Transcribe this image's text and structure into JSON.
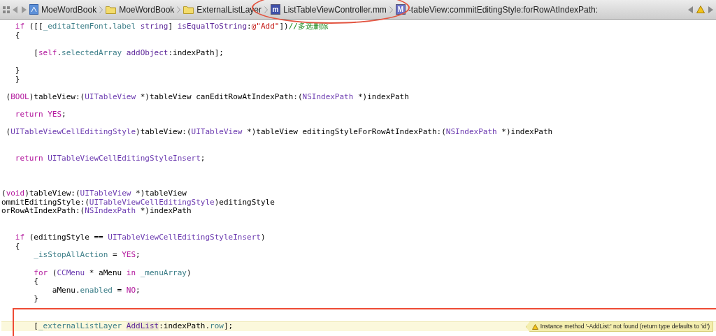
{
  "jump_bar": {
    "crumbs": [
      {
        "kind": "project",
        "label": "MoeWordBook"
      },
      {
        "kind": "folder",
        "label": "MoeWordBook"
      },
      {
        "kind": "folder",
        "label": "ExternalListLayer"
      },
      {
        "kind": "file",
        "label": "ListTableViewController.mm",
        "icon_letter": "m"
      },
      {
        "kind": "method",
        "label": "-tableView:commitEditingStyle:forRowAtIndexPath:",
        "icon_letter": "M"
      }
    ]
  },
  "code_lines": [
    {
      "kind": "code",
      "tokens": [
        {
          "text": "   if",
          "kind": "keyword"
        },
        {
          "text": " ([[",
          "kind": "plain"
        },
        {
          "text": "_editaItemFont",
          "kind": "property"
        },
        {
          "text": ".",
          "kind": "plain"
        },
        {
          "text": "label",
          "kind": "property"
        },
        {
          "text": " string",
          "kind": "method"
        },
        {
          "text": "] ",
          "kind": "plain"
        },
        {
          "text": "isEqualToString",
          "kind": "method"
        },
        {
          "text": ":",
          "kind": "plain"
        },
        {
          "text": "@\"Add\"",
          "kind": "string"
        },
        {
          "text": "])",
          "kind": "plain"
        },
        {
          "text": "//多选删除",
          "kind": "comment"
        }
      ]
    },
    {
      "kind": "code",
      "tokens": [
        {
          "text": "   {",
          "kind": "plain"
        }
      ]
    },
    {
      "kind": "blank"
    },
    {
      "kind": "code",
      "tokens": [
        {
          "text": "       [",
          "kind": "plain"
        },
        {
          "text": "self",
          "kind": "keyword"
        },
        {
          "text": ".",
          "kind": "plain"
        },
        {
          "text": "selectedArray",
          "kind": "property"
        },
        {
          "text": " addObject",
          "kind": "method"
        },
        {
          "text": ":indexPath];",
          "kind": "plain"
        }
      ]
    },
    {
      "kind": "blank"
    },
    {
      "kind": "code",
      "tokens": [
        {
          "text": "   }",
          "kind": "plain"
        }
      ]
    },
    {
      "kind": "code",
      "tokens": [
        {
          "text": "   }",
          "kind": "plain"
        }
      ]
    },
    {
      "kind": "blank"
    },
    {
      "kind": "code",
      "tokens": [
        {
          "text": " (",
          "kind": "plain"
        },
        {
          "text": "BOOL",
          "kind": "keyword"
        },
        {
          "text": ")tableView:(",
          "kind": "plain"
        },
        {
          "text": "UITableView",
          "kind": "type"
        },
        {
          "text": " *)tableView canEditRowAtIndexPath:(",
          "kind": "plain"
        },
        {
          "text": "NSIndexPath",
          "kind": "type"
        },
        {
          "text": " *)indexPath",
          "kind": "plain"
        }
      ]
    },
    {
      "kind": "blank"
    },
    {
      "kind": "code",
      "tokens": [
        {
          "text": "   return",
          "kind": "keyword"
        },
        {
          "text": " YES",
          "kind": "keyword"
        },
        {
          "text": ";",
          "kind": "plain"
        }
      ]
    },
    {
      "kind": "blank"
    },
    {
      "kind": "code",
      "tokens": [
        {
          "text": " (",
          "kind": "plain"
        },
        {
          "text": "UITableViewCellEditingStyle",
          "kind": "type"
        },
        {
          "text": ")tableView:(",
          "kind": "plain"
        },
        {
          "text": "UITableView",
          "kind": "type"
        },
        {
          "text": " *)tableView editingStyleForRowAtIndexPath:(",
          "kind": "plain"
        },
        {
          "text": "NSIndexPath",
          "kind": "type"
        },
        {
          "text": " *)indexPath",
          "kind": "plain"
        }
      ]
    },
    {
      "kind": "blank"
    },
    {
      "kind": "blank"
    },
    {
      "kind": "code",
      "tokens": [
        {
          "text": "   return",
          "kind": "keyword"
        },
        {
          "text": " UITableViewCellEditingStyleInsert",
          "kind": "type"
        },
        {
          "text": ";",
          "kind": "plain"
        }
      ]
    },
    {
      "kind": "blank"
    },
    {
      "kind": "blank"
    },
    {
      "kind": "blank"
    },
    {
      "kind": "code",
      "tokens": [
        {
          "text": "(",
          "kind": "plain"
        },
        {
          "text": "void",
          "kind": "keyword"
        },
        {
          "text": ")tableView:(",
          "kind": "plain"
        },
        {
          "text": "UITableView",
          "kind": "type"
        },
        {
          "text": " *)tableView",
          "kind": "plain"
        }
      ]
    },
    {
      "kind": "code",
      "tokens": [
        {
          "text": "ommitEditingStyle:(",
          "kind": "plain"
        },
        {
          "text": "UITableViewCellEditingStyle",
          "kind": "type"
        },
        {
          "text": ")editingStyle",
          "kind": "plain"
        }
      ]
    },
    {
      "kind": "code",
      "tokens": [
        {
          "text": "orRowAtIndexPath:(",
          "kind": "plain"
        },
        {
          "text": "NSIndexPath",
          "kind": "type"
        },
        {
          "text": " *)indexPath",
          "kind": "plain"
        }
      ]
    },
    {
      "kind": "blank"
    },
    {
      "kind": "blank"
    },
    {
      "kind": "code",
      "tokens": [
        {
          "text": "   if",
          "kind": "keyword"
        },
        {
          "text": " (editingStyle == ",
          "kind": "plain"
        },
        {
          "text": "UITableViewCellEditingStyleInsert",
          "kind": "type"
        },
        {
          "text": ")",
          "kind": "plain"
        }
      ]
    },
    {
      "kind": "code",
      "tokens": [
        {
          "text": "   {",
          "kind": "plain"
        }
      ]
    },
    {
      "kind": "code",
      "tokens": [
        {
          "text": "       _isStopAllAction",
          "kind": "property"
        },
        {
          "text": " = ",
          "kind": "plain"
        },
        {
          "text": "YES",
          "kind": "keyword"
        },
        {
          "text": ";",
          "kind": "plain"
        }
      ]
    },
    {
      "kind": "blank"
    },
    {
      "kind": "code",
      "tokens": [
        {
          "text": "       for",
          "kind": "keyword"
        },
        {
          "text": " (",
          "kind": "plain"
        },
        {
          "text": "CCMenu",
          "kind": "type"
        },
        {
          "text": " * aMenu ",
          "kind": "plain"
        },
        {
          "text": "in",
          "kind": "keyword"
        },
        {
          "text": " _menuArray",
          "kind": "property"
        },
        {
          "text": ")",
          "kind": "plain"
        }
      ]
    },
    {
      "kind": "code",
      "tokens": [
        {
          "text": "       {",
          "kind": "plain"
        }
      ]
    },
    {
      "kind": "code",
      "tokens": [
        {
          "text": "           aMenu.",
          "kind": "plain"
        },
        {
          "text": "enabled",
          "kind": "property"
        },
        {
          "text": " = ",
          "kind": "plain"
        },
        {
          "text": "NO",
          "kind": "keyword"
        },
        {
          "text": ";",
          "kind": "plain"
        }
      ]
    },
    {
      "kind": "code",
      "tokens": [
        {
          "text": "       }",
          "kind": "plain"
        }
      ]
    },
    {
      "kind": "blank"
    },
    {
      "kind": "blank"
    },
    {
      "kind": "code",
      "tokens": [
        {
          "text": "       [",
          "kind": "plain"
        },
        {
          "text": "_externalListLayer ",
          "kind": "property"
        },
        {
          "text": "AddList",
          "kind": "highlighted_method"
        },
        {
          "text": ":indexPath.",
          "kind": "plain"
        },
        {
          "text": "row",
          "kind": "property"
        },
        {
          "text": "];",
          "kind": "plain"
        }
      ],
      "warning": "Instance method '-AddList:' not found (return type defaults to 'id')"
    }
  ]
}
